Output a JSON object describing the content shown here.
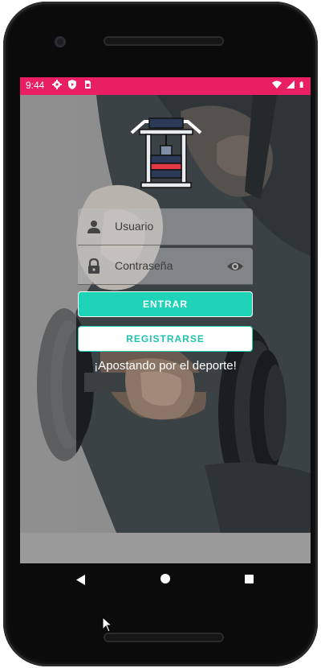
{
  "status_bar": {
    "time": "9:44",
    "left_icons": [
      "settings-icon",
      "shield-play-icon",
      "sim-card-icon"
    ],
    "right_icons": [
      "wifi-icon",
      "signal-icon",
      "battery-icon"
    ],
    "color": "#e91e63"
  },
  "login": {
    "username_placeholder": "Usuario",
    "password_placeholder": "Contraseña",
    "login_button": "ENTRAR",
    "register_button": "REGISTRARSE",
    "tagline": "¡Apostando por el deporte!",
    "accent_color": "#1fd3b8"
  },
  "nav_bar": {
    "buttons": [
      "back",
      "home",
      "recents"
    ]
  }
}
